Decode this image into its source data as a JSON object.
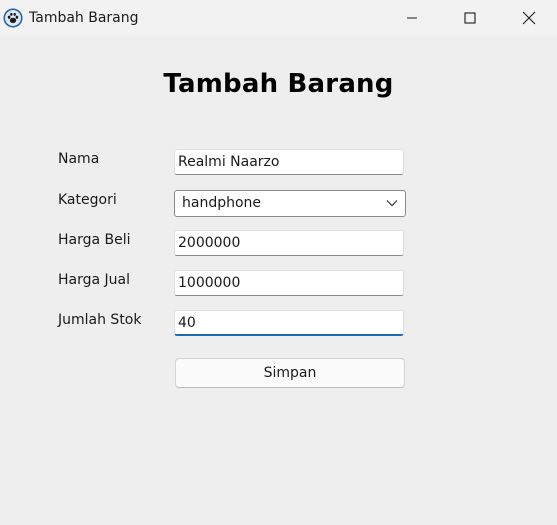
{
  "window": {
    "title": "Tambah Barang",
    "icon": "paw-icon"
  },
  "page": {
    "heading": "Tambah Barang"
  },
  "form": {
    "nama": {
      "label": "Nama",
      "value": "Realmi Naarzo"
    },
    "kategori": {
      "label": "Kategori",
      "value": "handphone"
    },
    "harga_beli": {
      "label": "Harga Beli",
      "value": "2000000"
    },
    "harga_jual": {
      "label": "Harga Jual",
      "value": "1000000"
    },
    "jumlah_stok": {
      "label": "Jumlah Stok",
      "value": "40"
    },
    "submit_label": "Simpan"
  },
  "colors": {
    "background": "#efeeee",
    "focus_accent": "#1a6fb8"
  }
}
